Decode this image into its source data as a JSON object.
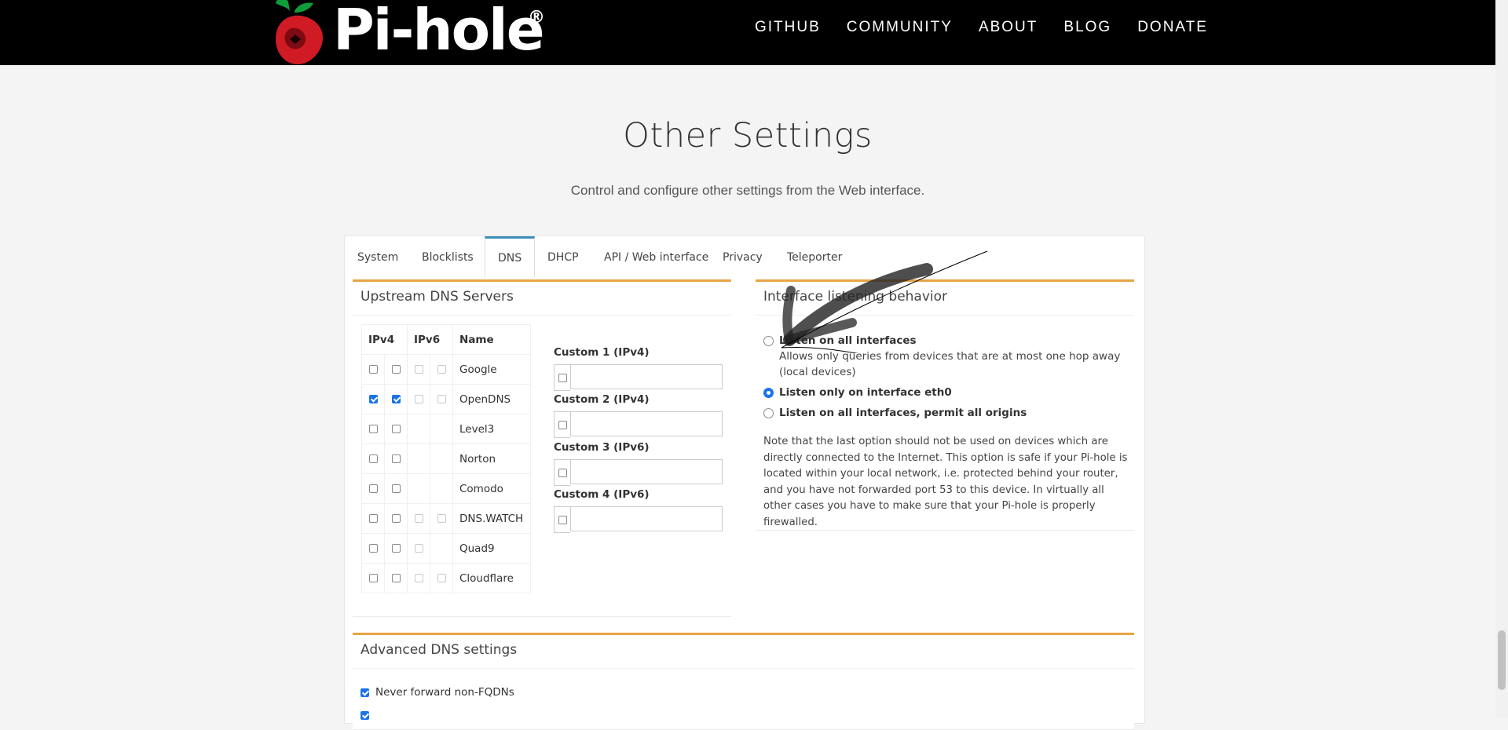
{
  "brand": {
    "name": "Pi-hole",
    "registered": "®"
  },
  "nav": [
    "GITHUB",
    "COMMUNITY",
    "ABOUT",
    "BLOG",
    "DONATE"
  ],
  "page": {
    "title": "Other Settings",
    "subtitle": "Control and configure other settings from the Web interface."
  },
  "tabs": [
    "System",
    "Blocklists",
    "DNS",
    "DHCP",
    "API / Web interface",
    "Privacy",
    "Teleporter"
  ],
  "active_tab": "DNS",
  "upstream": {
    "title": "Upstream DNS Servers",
    "headers": {
      "ipv4": "IPv4",
      "ipv6": "IPv6",
      "name": "Name"
    },
    "rows": [
      {
        "name": "Google",
        "v4": [
          false,
          false
        ],
        "v6": [
          false,
          false
        ],
        "v6_avail": [
          true,
          true
        ]
      },
      {
        "name": "OpenDNS",
        "v4": [
          true,
          true
        ],
        "v6": [
          false,
          false
        ],
        "v6_avail": [
          true,
          true
        ]
      },
      {
        "name": "Level3",
        "v4": [
          false,
          false
        ],
        "v6": [
          false,
          false
        ],
        "v6_avail": [
          false,
          false
        ]
      },
      {
        "name": "Norton",
        "v4": [
          false,
          false
        ],
        "v6": [
          false,
          false
        ],
        "v6_avail": [
          false,
          false
        ]
      },
      {
        "name": "Comodo",
        "v4": [
          false,
          false
        ],
        "v6": [
          false,
          false
        ],
        "v6_avail": [
          false,
          false
        ]
      },
      {
        "name": "DNS.WATCH",
        "v4": [
          false,
          false
        ],
        "v6": [
          false,
          false
        ],
        "v6_avail": [
          true,
          true
        ]
      },
      {
        "name": "Quad9",
        "v4": [
          false,
          false
        ],
        "v6": [
          false,
          false
        ],
        "v6_avail": [
          true,
          false
        ]
      },
      {
        "name": "Cloudflare",
        "v4": [
          false,
          false
        ],
        "v6": [
          false,
          false
        ],
        "v6_avail": [
          true,
          true
        ]
      }
    ],
    "custom": [
      {
        "label": "Custom 1 (IPv4)",
        "value": ""
      },
      {
        "label": "Custom 2 (IPv4)",
        "value": ""
      },
      {
        "label": "Custom 3 (IPv6)",
        "value": ""
      },
      {
        "label": "Custom 4 (IPv6)",
        "value": ""
      }
    ]
  },
  "interface": {
    "title": "Interface listening behavior",
    "options": [
      {
        "label": "Listen on all interfaces",
        "desc": "Allows only queries from devices that are at most one hop away (local devices)",
        "checked": false
      },
      {
        "label": "Listen only on interface eth0",
        "desc": "",
        "checked": true
      },
      {
        "label": "Listen on all interfaces, permit all origins",
        "desc": "",
        "checked": false
      }
    ],
    "note": "Note that the last option should not be used on devices which are directly connected to the Internet. This option is safe if your Pi-hole is located within your local network, i.e. protected behind your router, and you have not forwarded port 53 to this device. In virtually all other cases you have to make sure that your Pi-hole is properly firewalled."
  },
  "advanced": {
    "title": "Advanced DNS settings",
    "items": [
      {
        "label": "Never forward non-FQDNs",
        "checked": true
      }
    ]
  },
  "colors": {
    "accent": "#e8a444",
    "tab_active": "#3c8dbc",
    "check": "#1a73e8"
  }
}
